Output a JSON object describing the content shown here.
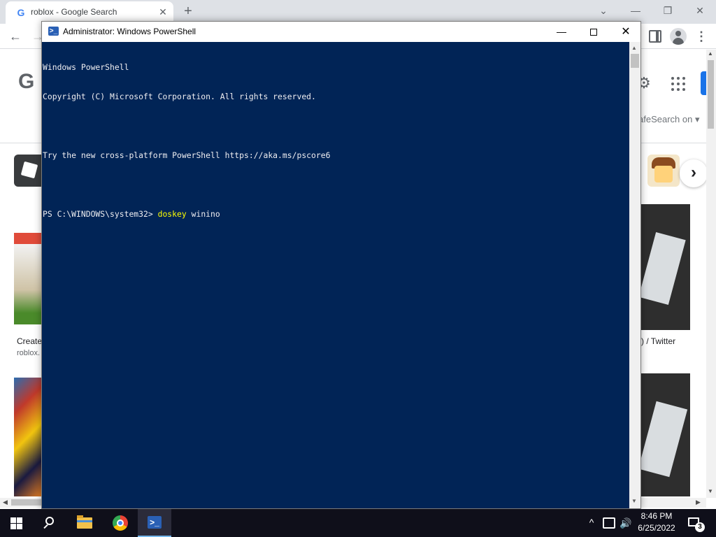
{
  "browser": {
    "tab": {
      "title": "roblox - Google Search",
      "favicon": "G",
      "close": "✕"
    },
    "new_tab": "+",
    "window_controls": {
      "dropdown": "⌄",
      "minimize": "—",
      "restore": "❐",
      "close": "✕"
    },
    "nav": {
      "back": "←",
      "forward": "→",
      "menu": "⋮"
    },
    "logo_partial": "G",
    "safesearch": "afeSearch on ▾",
    "captions": {
      "left": "Create",
      "left_sub": "roblox.",
      "right": ") / Twitter"
    },
    "next_chevron": "›"
  },
  "powershell": {
    "title": "Administrator: Windows PowerShell",
    "icon": ">_",
    "controls": {
      "minimize": "—",
      "close": "✕"
    },
    "lines": [
      "Windows PowerShell",
      "Copyright (C) Microsoft Corporation. All rights reserved.",
      "",
      "Try the new cross-platform PowerShell https://aka.ms/pscore6",
      ""
    ],
    "prompt": "PS C:\\WINDOWS\\system32> ",
    "command": "doskey",
    "argument": " winino"
  },
  "taskbar": {
    "powershell_icon": ">_",
    "tray_chevron": "^",
    "volume": "🔊",
    "time": "8:46 PM",
    "date": "6/25/2022",
    "notification_count": "3"
  },
  "icons": {
    "start": "windows-logo-icon",
    "search": "search-icon",
    "explorer": "folder-icon",
    "chrome": "chrome-icon",
    "powershell": "powershell-icon",
    "settings": "gear-icon",
    "apps": "apps-grid-icon"
  },
  "colors": {
    "console_bg": "#012456",
    "console_text": "#eeedf0",
    "command_highlight": "#ffff00",
    "taskbar_bg": "#0f0f1a"
  }
}
